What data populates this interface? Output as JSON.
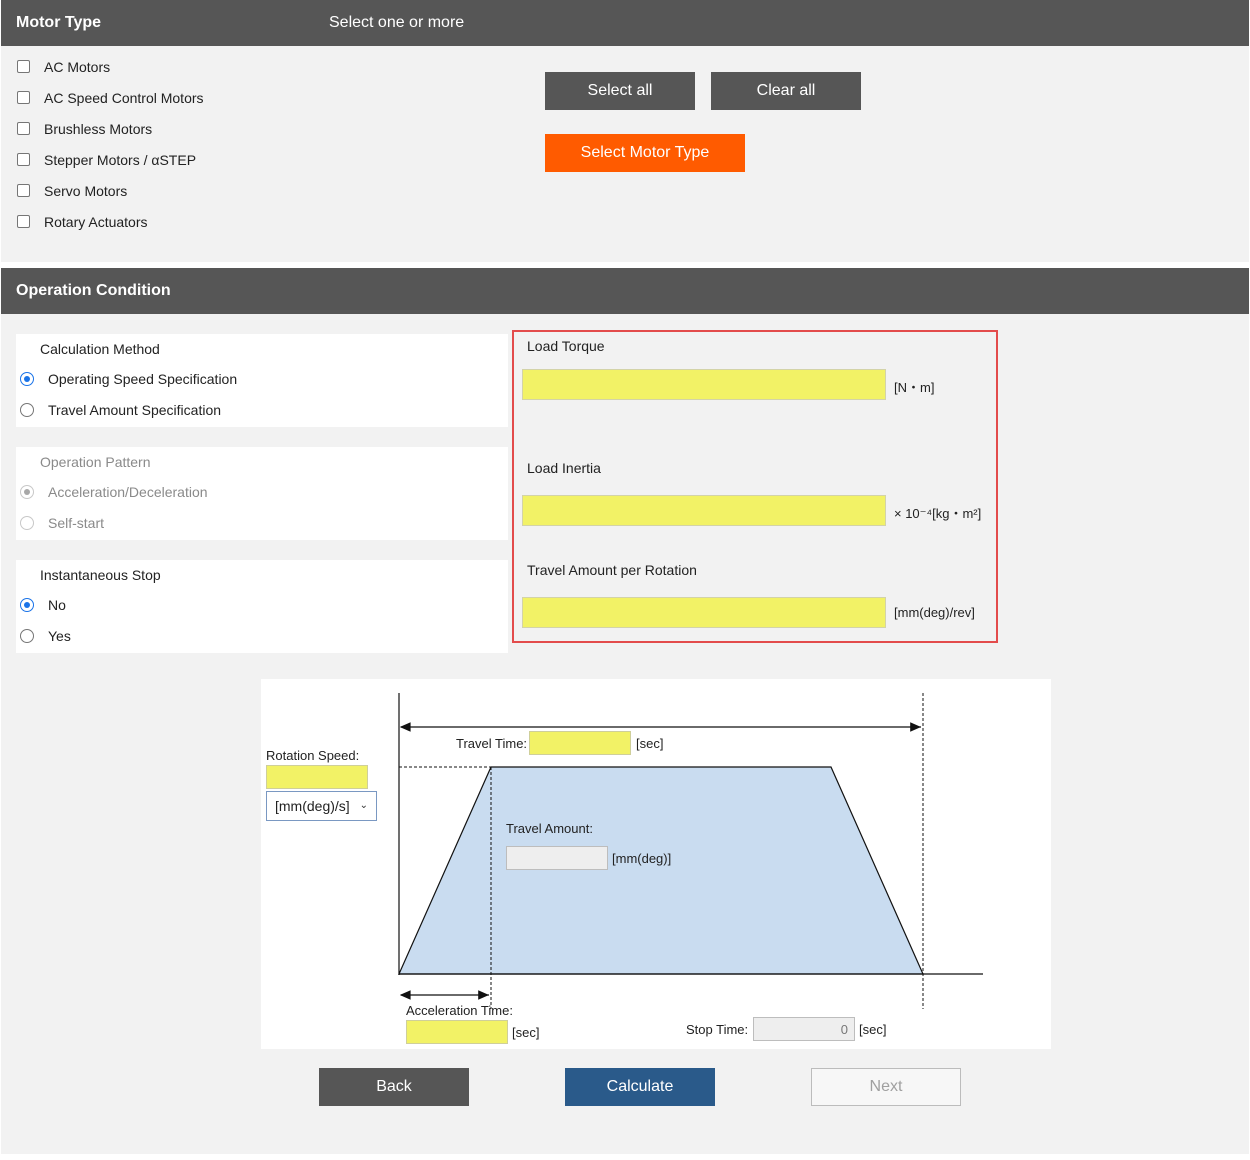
{
  "motor_type": {
    "title": "Motor Type",
    "subtitle": "Select one or more",
    "options": [
      {
        "label": "AC Motors",
        "checked": false
      },
      {
        "label": "AC Speed Control Motors",
        "checked": false
      },
      {
        "label": "Brushless Motors",
        "checked": false
      },
      {
        "label": "Stepper Motors / αSTEP",
        "checked": false
      },
      {
        "label": "Servo Motors",
        "checked": false
      },
      {
        "label": "Rotary Actuators",
        "checked": false
      }
    ],
    "select_all_label": "Select all",
    "clear_all_label": "Clear all",
    "select_motor_type_label": "Select Motor Type"
  },
  "operation_condition": {
    "title": "Operation Condition",
    "calculation_method": {
      "title": "Calculation Method",
      "options": [
        {
          "label": "Operating Speed Specification",
          "selected": true
        },
        {
          "label": "Travel Amount Specification",
          "selected": false
        }
      ]
    },
    "operation_pattern": {
      "title": "Operation Pattern",
      "disabled": true,
      "options": [
        {
          "label": "Acceleration/Deceleration",
          "selected": true
        },
        {
          "label": "Self-start",
          "selected": false
        }
      ]
    },
    "instantaneous_stop": {
      "title": "Instantaneous Stop",
      "options": [
        {
          "label": "No",
          "selected": true
        },
        {
          "label": "Yes",
          "selected": false
        }
      ]
    },
    "load": {
      "load_torque_label": "Load Torque",
      "load_torque_value": "",
      "load_torque_unit": "[N・m]",
      "load_inertia_label": "Load Inertia",
      "load_inertia_value": "",
      "load_inertia_unit": "× 10⁻⁴[kg・m²]",
      "travel_per_rotation_label": "Travel Amount per Rotation",
      "travel_per_rotation_value": "",
      "travel_per_rotation_unit": "[mm(deg)/rev]"
    },
    "diagram": {
      "rotation_speed_label": "Rotation Speed:",
      "rotation_speed_value": "",
      "rotation_speed_unit": "[mm(deg)/s]",
      "travel_time_label": "Travel Time:",
      "travel_time_value": "",
      "travel_time_unit": "[sec]",
      "travel_amount_label": "Travel Amount:",
      "travel_amount_value": "",
      "travel_amount_unit": "[mm(deg)]",
      "acceleration_time_label": "Acceleration Time:",
      "acceleration_time_value": "",
      "acceleration_time_unit": "[sec]",
      "stop_time_label": "Stop Time:",
      "stop_time_value": "0",
      "stop_time_unit": "[sec]"
    },
    "back_label": "Back",
    "calculate_label": "Calculate",
    "next_label": "Next"
  },
  "colors": {
    "header_bg": "#565656",
    "accent_orange": "#ff5b00",
    "primary_blue": "#2a5a8a",
    "input_yellow": "#f2f266",
    "highlight_red": "#e34c4c",
    "diagram_fill": "#c9dcf0"
  }
}
